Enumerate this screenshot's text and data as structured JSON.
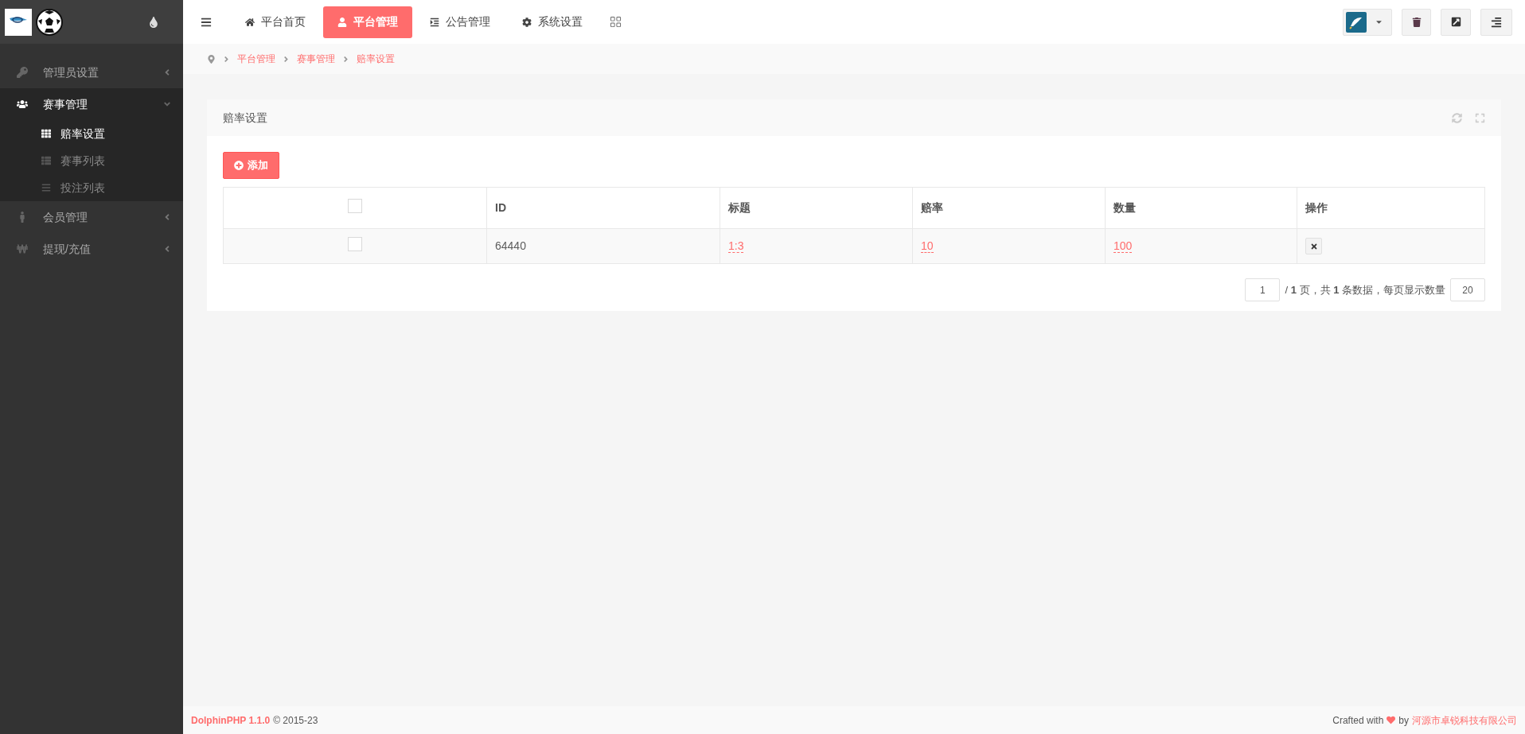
{
  "sidebar": {
    "menu": [
      {
        "label": "管理员设置",
        "expanded": false
      },
      {
        "label": "赛事管理",
        "expanded": true,
        "children": [
          {
            "label": "赔率设置",
            "selected": true
          },
          {
            "label": "赛事列表",
            "selected": false
          },
          {
            "label": "投注列表",
            "selected": false
          }
        ]
      },
      {
        "label": "会员管理",
        "expanded": false
      },
      {
        "label": "提现/充值",
        "expanded": false
      }
    ]
  },
  "top_nav": [
    {
      "label": "平台首页",
      "selected": false
    },
    {
      "label": "平台管理",
      "selected": true
    },
    {
      "label": "公告管理",
      "selected": false
    },
    {
      "label": "系统设置",
      "selected": false
    }
  ],
  "breadcrumb": [
    "平台管理",
    "赛事管理",
    "赔率设置"
  ],
  "panel": {
    "title": "赔率设置",
    "add_button": "添加",
    "table": {
      "columns": [
        "ID",
        "标题",
        "赔率",
        "数量",
        "操作"
      ],
      "header_checked": false,
      "rows": [
        {
          "checked": false,
          "id": "64440",
          "title": "1:3",
          "odds": "10",
          "amount": "100"
        }
      ]
    },
    "pagination": {
      "page": "1",
      "summary": "/ **1** 页，共 **1** 条数据，每页显示数量",
      "per_page": "20"
    }
  },
  "footer": {
    "brand": "DolphinPHP 1.1.0",
    "copyright": "© 2015-23",
    "crafted": "Crafted with",
    "by": "by",
    "company": "河源市卓锐科技有限公司"
  }
}
